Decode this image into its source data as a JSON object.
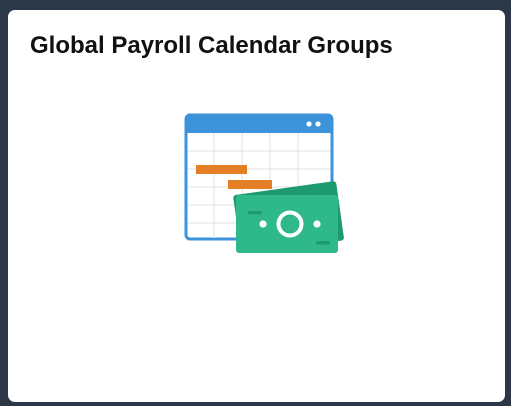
{
  "tile": {
    "title": "Global Payroll Calendar Groups",
    "icon": "calendar-money-icon"
  },
  "colors": {
    "page_background": "#2c3848",
    "tile_background": "#ffffff",
    "calendar_header": "#3d93d9",
    "calendar_bar": "#e57f25",
    "money": "#2fb98a",
    "money_dark": "#1e9a71"
  }
}
